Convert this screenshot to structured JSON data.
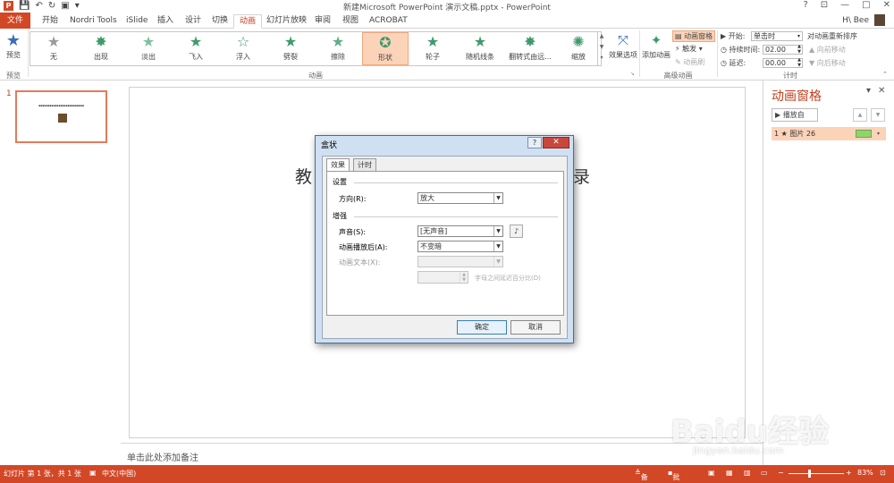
{
  "titlebar": {
    "title": "新建Microsoft PowerPoint 演示文稿.pptx - PowerPoint",
    "help": "?",
    "restore": "⊡",
    "minimize": "—",
    "maximize": "□",
    "close": "✕"
  },
  "tabs": {
    "file": "文件",
    "items": [
      "开始",
      "Nordri Tools",
      "iSlide",
      "插入",
      "设计",
      "切换",
      "动画",
      "幻灯片放映",
      "审阅",
      "视图",
      "ACROBAT"
    ],
    "active": "动画",
    "user": "H\\ Bee"
  },
  "ribbon": {
    "preview_label": "预览",
    "preview_group": "预览",
    "animations": [
      "无",
      "出现",
      "淡出",
      "飞入",
      "浮入",
      "劈裂",
      "擦除",
      "形状",
      "轮子",
      "随机线条",
      "翻转式由远...",
      "缩放"
    ],
    "selected_animation": "形状",
    "animation_group": "动画",
    "effect_options": "效果选项",
    "add_animation": "添加动画",
    "animation_pane": "动画窗格",
    "trigger": "触发",
    "animation_painter": "动画刷",
    "advanced_group": "高级动画",
    "start_label": "开始:",
    "start_value": "单击时",
    "duration_label": "持续时间:",
    "duration_value": "02.00",
    "delay_label": "延迟:",
    "delay_value": "00.00",
    "reorder_title": "对动画重新排序",
    "move_earlier": "向前移动",
    "move_later": "向后移动",
    "timing_group": "计时"
  },
  "thumbnail": {
    "number": "1"
  },
  "slide": {
    "title_left": "教",
    "title_right": "录"
  },
  "notes": {
    "placeholder": "单击此处添加备注"
  },
  "animpane": {
    "title": "动画窗格",
    "play_from": "播放自",
    "item": "1 ★ 图片 26"
  },
  "dialog": {
    "title": "盒状",
    "tab_effect": "效果",
    "tab_timing": "计时",
    "section_settings": "设置",
    "direction_label": "方向(R):",
    "direction_value": "放大",
    "section_enhance": "增强",
    "sound_label": "声音(S):",
    "sound_value": "[无声音]",
    "after_label": "动画播放后(A):",
    "after_value": "不变暗",
    "text_label": "动画文本(X):",
    "delay_pct_label": "字母之间延迟百分比(D)",
    "ok": "确定",
    "cancel": "取消"
  },
  "statusbar": {
    "slide_info": "幻灯片 第 1 张，共 1 张",
    "language": "中文(中国)",
    "notes": "备注",
    "comments": "批注",
    "zoom": "83%"
  },
  "watermark": {
    "logo": "Baidu经验",
    "url": "jingyan.baidu.com"
  },
  "colors": {
    "accent": "#d24726",
    "highlight": "#fbd3b9",
    "star_green": "#3f9a6b"
  }
}
